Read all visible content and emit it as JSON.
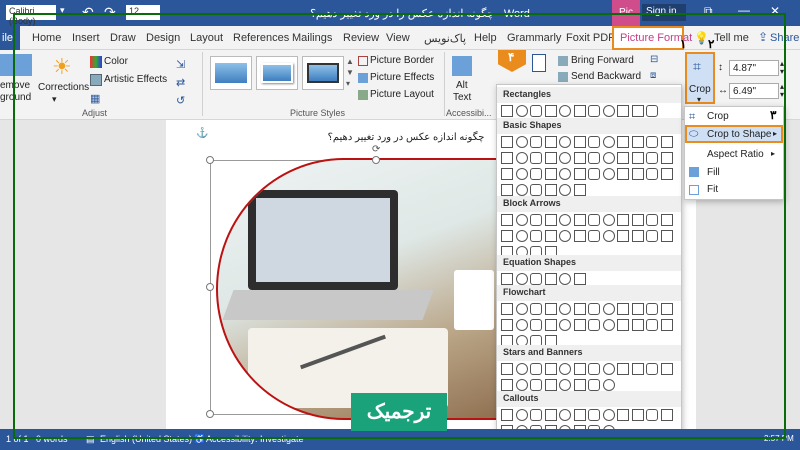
{
  "window": {
    "title": "چگونه اندازه عکس را در ورد تغییر دهیم؟  -  Word",
    "font_box": "Calibri (Body)",
    "size_box": "12",
    "context_label": "Pic",
    "sign_in": "Sign in"
  },
  "tabs": [
    "ile",
    "Home",
    "Insert",
    "Draw",
    "Design",
    "Layout",
    "References",
    "Mailings",
    "Review",
    "View",
    "پاک‌نویس",
    "Help",
    "Grammarly",
    "Foxit PDF",
    "Picture Format",
    "Tell me",
    "Share"
  ],
  "ribbon": {
    "remove_bg": [
      "emove",
      "ground"
    ],
    "corrections": "Corrections",
    "color": "Color",
    "artistic": "Artistic Effects",
    "group_adjust": "Adjust",
    "picture_border": "Picture Border",
    "picture_effects": "Picture Effects",
    "picture_layout": "Picture Layout",
    "group_styles": "Picture Styles",
    "alt_text": [
      "Alt",
      "Text"
    ],
    "group_access": "Accessibi...",
    "bring_forward": "Bring Forward",
    "send_backward": "Send Backward",
    "crop": "Crop",
    "height": "4.87\"",
    "width": "6.49\""
  },
  "document": {
    "caption": "چگونه اندازه عکس در ورد تغییر دهیم؟"
  },
  "crop_menu": {
    "items": [
      "Crop",
      "Crop to Shape",
      "Aspect Ratio",
      "Fill",
      "Fit"
    ]
  },
  "shapes_menu": {
    "sections": [
      "Rectangles",
      "Basic Shapes",
      "Block Arrows",
      "Equation Shapes",
      "Flowchart",
      "Stars and Banners",
      "Callouts"
    ]
  },
  "annotations": {
    "n1": "۱",
    "n2": "۲",
    "n3": "۳",
    "n4": "۴"
  },
  "watermark": "ترجمیک",
  "status": {
    "page": "1 of 1",
    "words": "0 words",
    "language": "English (United States)",
    "accessibility": "Accessibility: Investigate",
    "time": "2:57 PM"
  },
  "colors": {
    "word_blue": "#2b579a",
    "accent_orange": "#e98b1d",
    "frame_green": "#0a6b0a",
    "watermark_teal": "#1aa37a"
  }
}
